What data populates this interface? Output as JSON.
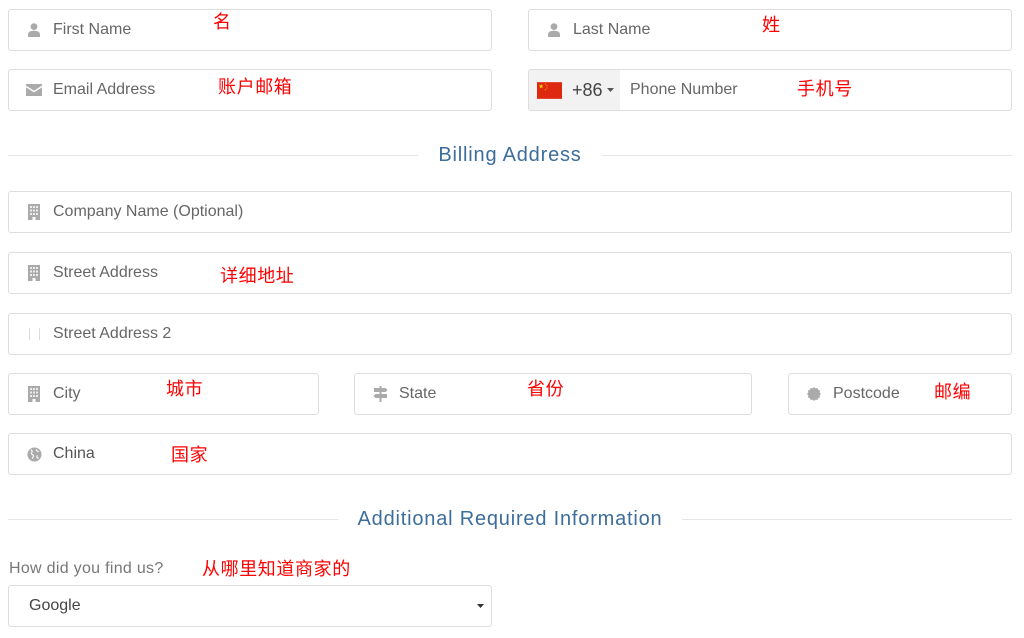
{
  "colors": {
    "heading": "#3d6d9a",
    "annotation": "#ff0000",
    "icon": "#aaaaaa",
    "border": "#dddddd",
    "rule": "#e5e5e5",
    "placeholder": "#666666",
    "value_text": "#555555",
    "label": "#777777",
    "dial_bg": "#f2f2f2"
  },
  "personal": {
    "first_name": {
      "placeholder": "First Name",
      "annotation": "名",
      "icon": "user-icon"
    },
    "last_name": {
      "placeholder": "Last Name",
      "annotation": "姓",
      "icon": "user-icon"
    },
    "email": {
      "placeholder": "Email Address",
      "annotation": "账户邮箱",
      "icon": "envelope-icon"
    },
    "phone": {
      "flag": "china-flag-icon",
      "dial_code": "+86",
      "placeholder": "Phone Number",
      "annotation": "手机号"
    }
  },
  "billing": {
    "title": "Billing Address",
    "company": {
      "placeholder": "Company Name (Optional)",
      "icon": "building-icon"
    },
    "street": {
      "placeholder": "Street Address",
      "annotation": "详细地址",
      "icon": "building-icon"
    },
    "street2": {
      "placeholder": "Street Address 2",
      "icon": "building-outline-icon"
    },
    "city": {
      "placeholder": "City",
      "annotation": "城市",
      "icon": "building-icon"
    },
    "state": {
      "placeholder": "State",
      "annotation": "省份",
      "icon": "signpost-icon"
    },
    "postcode": {
      "placeholder": "Postcode",
      "annotation": "邮编",
      "icon": "certificate-icon"
    },
    "country": {
      "value": "China",
      "annotation": "国家",
      "icon": "globe-icon"
    }
  },
  "additional": {
    "title": "Additional Required Information",
    "referral": {
      "label": "How did you find us?",
      "annotation": "从哪里知道商家的",
      "selected": "Google"
    }
  }
}
